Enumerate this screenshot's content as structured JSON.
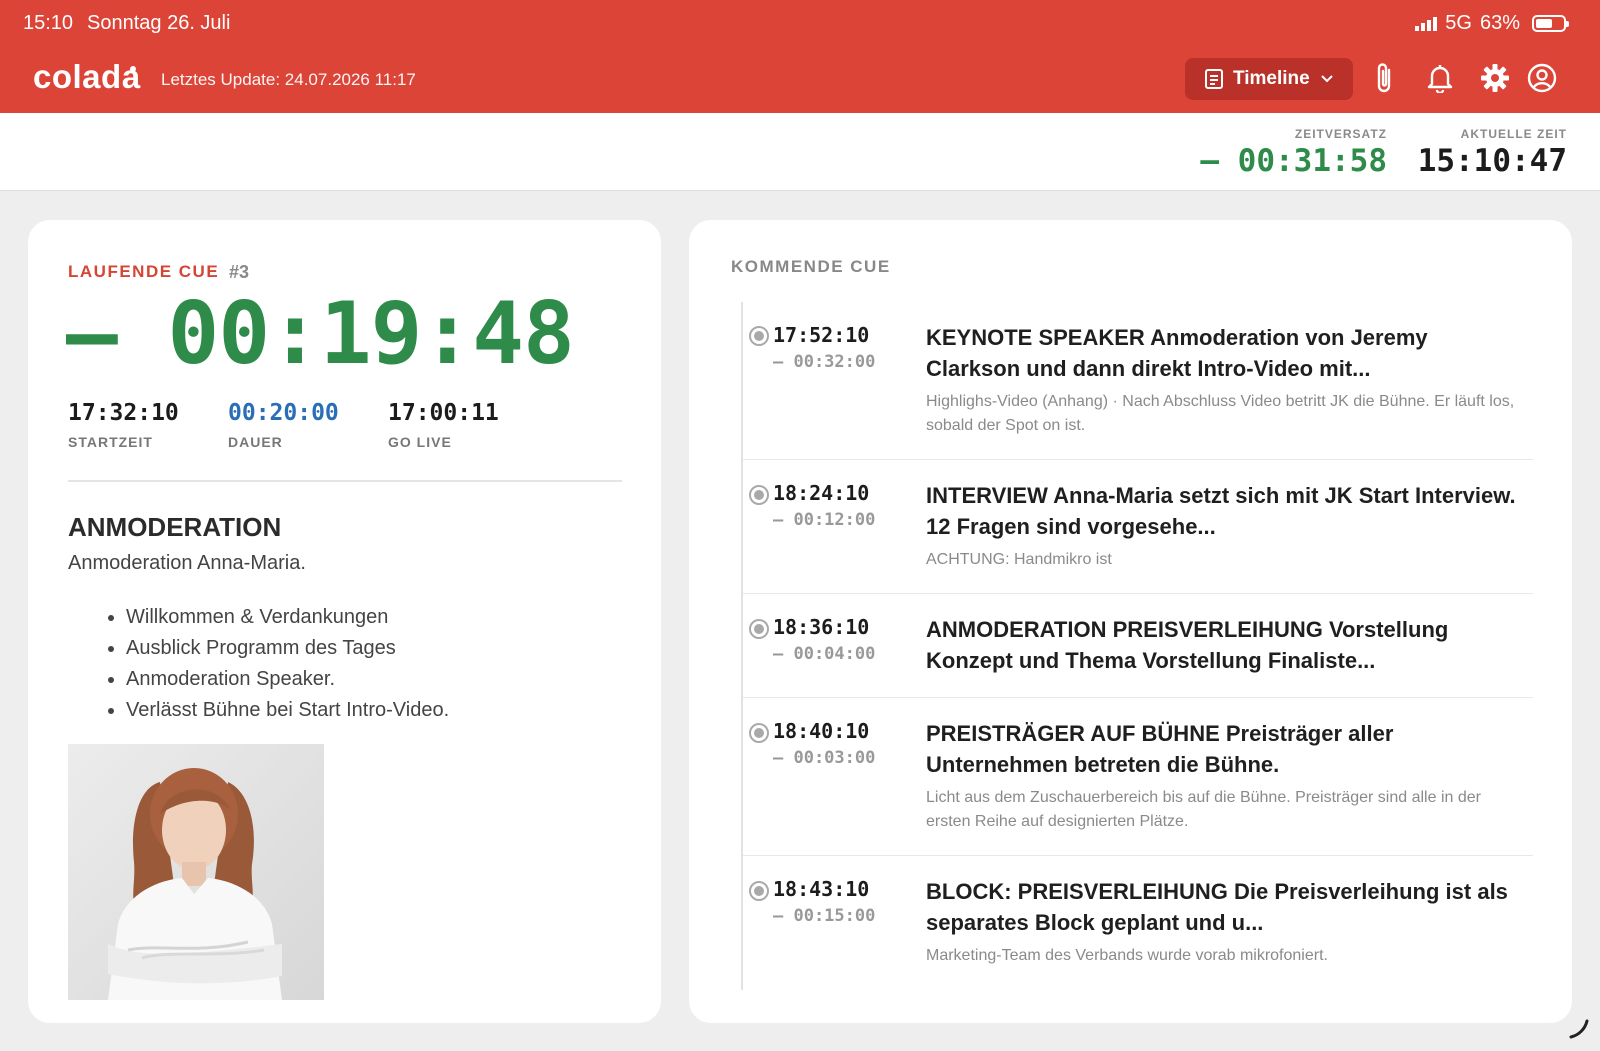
{
  "status_bar": {
    "time": "15:10",
    "date": "Sonntag 26. Juli",
    "network": "5G",
    "battery": "63%",
    "battery_level": 0.63
  },
  "header": {
    "logo": "colada",
    "last_update": "Letztes Update: 24.07.2026 11:17",
    "view_button": "Timeline",
    "icons": [
      "paperclip-icon",
      "bell-icon",
      "gear-icon",
      "user-icon"
    ]
  },
  "clock": {
    "offset_label": "ZEITVERSATZ",
    "offset_value": "– 00:31:58",
    "current_label": "AKTUELLE ZEIT",
    "current_value": "15:10:47"
  },
  "current_cue": {
    "label": "LAUFENDE CUE",
    "number": "#3",
    "countdown": "– 00:19:48",
    "start_time": "17:32:10",
    "start_label": "STARTZEIT",
    "duration": "00:20:00",
    "duration_label": "DAUER",
    "go_live": "17:00:11",
    "go_live_label": "GO LIVE",
    "section_title": "ANMODERATION",
    "section_sub": "Anmoderation Anna-Maria.",
    "bullets": [
      "Willkommen & Verdankungen",
      "Ausblick Programm des Tages",
      "Anmoderation Speaker.",
      "Verlässt Bühne bei Start Intro-Video."
    ]
  },
  "upcoming": {
    "label": "KOMMENDE CUE",
    "items": [
      {
        "time": "17:52:10",
        "duration": "– 00:32:00",
        "title": "KEYNOTE SPEAKER Anmoderation von Jeremy Clarkson und dann direkt Intro-Video mit...",
        "desc": "Highlighs-Video (Anhang) · Nach Abschluss Video betritt JK die Bühne. Er läuft los, sobald der Spot on ist."
      },
      {
        "time": "18:24:10",
        "duration": "– 00:12:00",
        "title": "INTERVIEW Anna-Maria setzt sich mit JK Start Interview. 12 Fragen sind vorgesehe...",
        "desc": "ACHTUNG: Handmikro ist"
      },
      {
        "time": "18:36:10",
        "duration": "– 00:04:00",
        "title": "ANMODERATION PREISVERLEIHUNG Vorstellung Konzept und Thema Vorstellung Finaliste...",
        "desc": ""
      },
      {
        "time": "18:40:10",
        "duration": "– 00:03:00",
        "title": "PREISTRÄGER AUF BÜHNE Preisträger aller Unternehmen betreten die Bühne.",
        "desc": "Licht aus dem Zuschauerbereich bis auf die Bühne. Preisträger sind alle in der ersten Reihe auf designierten Plätze."
      },
      {
        "time": "18:43:10",
        "duration": "– 00:15:00",
        "title": "BLOCK: PREISVERLEIHUNG Die Preisverleihung ist als separates Block geplant und u...",
        "desc": "Marketing-Team des Verbands wurde vorab mikrofoniert."
      }
    ]
  },
  "colors": {
    "brand": "#dc4438",
    "green": "#2e8b4a",
    "blue": "#2a6eb8"
  }
}
